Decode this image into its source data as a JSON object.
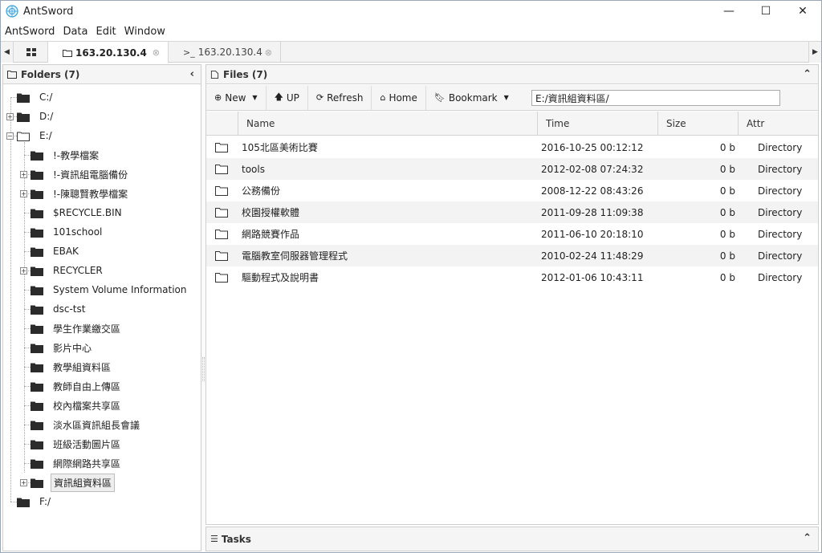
{
  "window": {
    "title": "AntSword",
    "min": "—",
    "max": "☐",
    "close": "✕"
  },
  "menu": [
    "AntSword",
    "Data",
    "Edit",
    "Window"
  ],
  "tabs": {
    "active": "163.20.130.4",
    "terminal": "163.20.130.4",
    "close_glyph": "⊗",
    "term_prefix": ">_"
  },
  "folders": {
    "title": "Folders (7)",
    "items": [
      {
        "label": "C:/",
        "level": 0,
        "expander": ""
      },
      {
        "label": "D:/",
        "level": 0,
        "expander": "+"
      },
      {
        "label": "E:/",
        "level": 0,
        "expander": "−",
        "open": true
      },
      {
        "label": "!-教學檔案",
        "level": 1,
        "expander": ""
      },
      {
        "label": "!-資訊組電腦備份",
        "level": 1,
        "expander": "+"
      },
      {
        "label": "!-陳聰賢教學檔案",
        "level": 1,
        "expander": "+"
      },
      {
        "label": "$RECYCLE.BIN",
        "level": 1,
        "expander": ""
      },
      {
        "label": "101school",
        "level": 1,
        "expander": ""
      },
      {
        "label": "EBAK",
        "level": 1,
        "expander": ""
      },
      {
        "label": "RECYCLER",
        "level": 1,
        "expander": "+"
      },
      {
        "label": "System Volume Information",
        "level": 1,
        "expander": ""
      },
      {
        "label": "dsc-tst",
        "level": 1,
        "expander": ""
      },
      {
        "label": "學生作業繳交區",
        "level": 1,
        "expander": ""
      },
      {
        "label": "影片中心",
        "level": 1,
        "expander": ""
      },
      {
        "label": "教學組資料區",
        "level": 1,
        "expander": ""
      },
      {
        "label": "教師自由上傳區",
        "level": 1,
        "expander": ""
      },
      {
        "label": "校內檔案共享區",
        "level": 1,
        "expander": ""
      },
      {
        "label": "淡水區資訊組長會議",
        "level": 1,
        "expander": ""
      },
      {
        "label": "班級活動圖片區",
        "level": 1,
        "expander": ""
      },
      {
        "label": "網際網路共享區",
        "level": 1,
        "expander": ""
      },
      {
        "label": "資訊組資料區",
        "level": 1,
        "expander": "+",
        "selected": true
      },
      {
        "label": "F:/",
        "level": 0,
        "expander": ""
      }
    ]
  },
  "files": {
    "title": "Files (7)",
    "toolbar": {
      "new": "New",
      "up": "UP",
      "refresh": "Refresh",
      "home": "Home",
      "bookmark": "Bookmark",
      "path": "E:/資訊組資料區/"
    },
    "columns": [
      "Name",
      "Time",
      "Size",
      "Attr"
    ],
    "rows": [
      {
        "name": "105北區美術比賽",
        "time": "2016-10-25 00:12:12",
        "size": "0 b",
        "attr": "Directory"
      },
      {
        "name": "tools",
        "time": "2012-02-08 07:24:32",
        "size": "0 b",
        "attr": "Directory"
      },
      {
        "name": "公務備份",
        "time": "2008-12-22 08:43:26",
        "size": "0 b",
        "attr": "Directory"
      },
      {
        "name": "校園授權軟體",
        "time": "2011-09-28 11:09:38",
        "size": "0 b",
        "attr": "Directory"
      },
      {
        "name": "網路競賽作品",
        "time": "2011-06-10 20:18:10",
        "size": "0 b",
        "attr": "Directory"
      },
      {
        "name": "電腦教室伺服器管理程式",
        "time": "2010-02-24 11:48:29",
        "size": "0 b",
        "attr": "Directory"
      },
      {
        "name": "驅動程式及說明書",
        "time": "2012-01-06 10:43:11",
        "size": "0 b",
        "attr": "Directory"
      }
    ]
  },
  "tasks": {
    "title": "Tasks"
  }
}
